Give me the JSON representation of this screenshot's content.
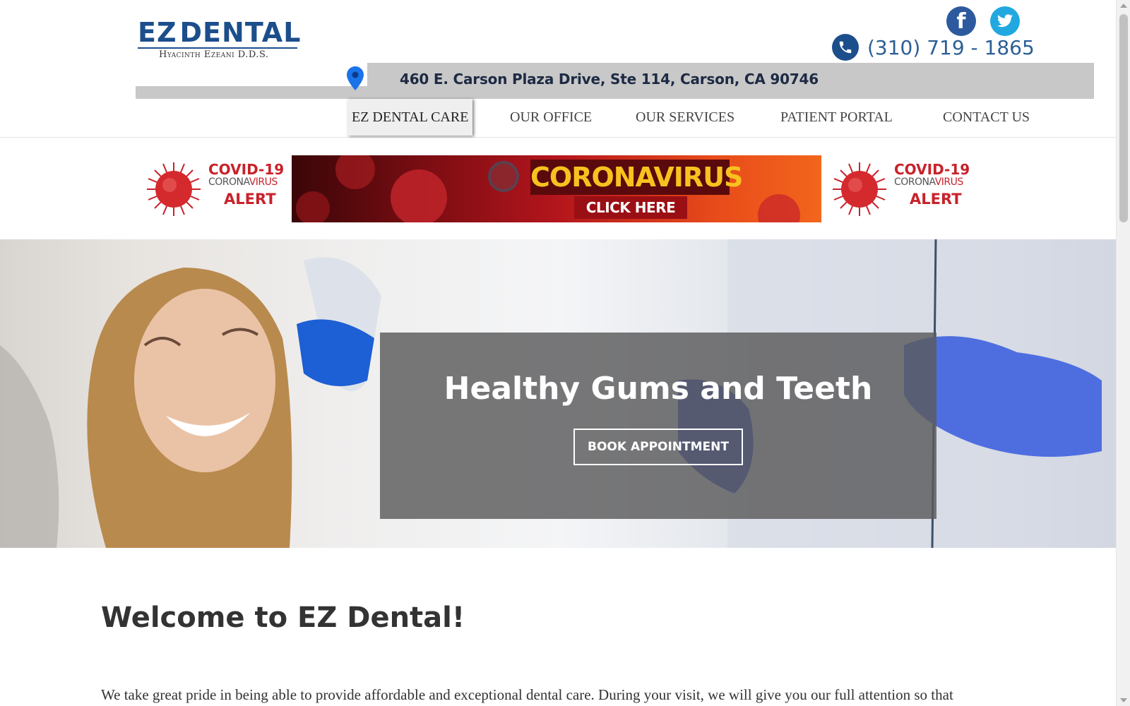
{
  "header": {
    "logo_text_left": "EZ",
    "logo_text_right": "DENTAL",
    "logo_subtitle": "Hyacinth Ezeani D.D.S.",
    "phone": "(310) 719 - 1865",
    "address": "460 E. Carson Plaza Drive, Ste 114, Carson, CA 90746",
    "social": [
      {
        "name": "facebook",
        "glyph": "f",
        "color": "#2d5a9e"
      },
      {
        "name": "twitter",
        "glyph": "🐦",
        "color": "#21a8e0"
      }
    ]
  },
  "nav": {
    "items": [
      {
        "label": "EZ DENTAL CARE",
        "active": true
      },
      {
        "label": "OUR OFFICE",
        "active": false
      },
      {
        "label": "OUR SERVICES",
        "active": false
      },
      {
        "label": "PATIENT PORTAL",
        "active": false
      },
      {
        "label": "CONTACT US",
        "active": false
      }
    ]
  },
  "covid": {
    "title": "COVID-19",
    "subtitle_left": "CORONA",
    "subtitle_right": "VIRUS",
    "alert": "ALERT",
    "banner_word": "CORONAVIRUS",
    "banner_cta": "CLICK HERE"
  },
  "hero": {
    "title": "Healthy Gums and Teeth",
    "button_label": "BOOK APPOINTMENT"
  },
  "welcome": {
    "title": "Welcome to EZ Dental!",
    "text": "We take great pride in being able to provide affordable and exceptional dental care. During your visit, we will give you our full attention so that"
  },
  "colors": {
    "brand_blue": "#1c4e8c",
    "accent_orange": "#e8832a",
    "covid_red": "#c8222a",
    "address_bar": "#c8c8c8"
  }
}
